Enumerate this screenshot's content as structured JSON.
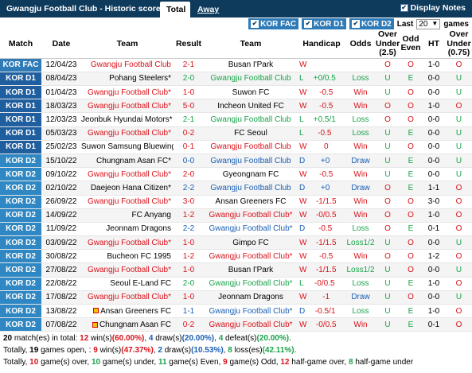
{
  "header": {
    "title": "Gwangju Football Club - Historic scores",
    "tab_total": "Total",
    "tab_away": "Away",
    "display_notes": "Display Notes"
  },
  "filters": {
    "items": [
      "KOR FAC",
      "KOR D1",
      "KOR D2"
    ],
    "last_label": "Last",
    "last_value": "20",
    "games_label": "games"
  },
  "columns": [
    "Match",
    "Date",
    "Team",
    "Result",
    "Team",
    "Handicap",
    "Odds",
    "Over Under (2.5)",
    "Odd Even",
    "HT",
    "Over Under (0.75)"
  ],
  "rows": [
    {
      "league": "KOR FAC",
      "lc": "l-fac",
      "date": "12/04/23",
      "home": "Gwangju Football Club",
      "hc": "red",
      "score": "2-1",
      "away": "Busan I'Park",
      "ac": "",
      "res": "W",
      "hcp": "",
      "odds": "",
      "ou": "O",
      "oe": "O",
      "ht": "1-0",
      "ou2": "O"
    },
    {
      "league": "KOR D1",
      "lc": "l-d1",
      "date": "08/04/23",
      "home": "Pohang Steelers*",
      "hc": "",
      "score": "2-0",
      "away": "Gwangju Football Club",
      "ac": "green",
      "res": "L",
      "hcp": "+0/0.5",
      "odds": "Loss",
      "ou": "U",
      "oe": "E",
      "ht": "0-0",
      "ou2": "U"
    },
    {
      "league": "KOR D1",
      "lc": "l-d1",
      "date": "01/04/23",
      "home": "Gwangju Football Club*",
      "hc": "red",
      "score": "1-0",
      "away": "Suwon FC",
      "ac": "",
      "res": "W",
      "hcp": "-0.5",
      "odds": "Win",
      "ou": "U",
      "oe": "O",
      "ht": "0-0",
      "ou2": "U"
    },
    {
      "league": "KOR D1",
      "lc": "l-d1",
      "date": "18/03/23",
      "home": "Gwangju Football Club*",
      "hc": "red",
      "score": "5-0",
      "away": "Incheon United FC",
      "ac": "",
      "res": "W",
      "hcp": "-0.5",
      "odds": "Win",
      "ou": "O",
      "oe": "O",
      "ht": "1-0",
      "ou2": "O"
    },
    {
      "league": "KOR D1",
      "lc": "l-d1",
      "date": "12/03/23",
      "home": "Jeonbuk Hyundai Motors*",
      "hc": "",
      "score": "2-1",
      "away": "Gwangju Football Club",
      "ac": "green",
      "res": "L",
      "hcp": "+0.5/1",
      "odds": "Loss",
      "ou": "O",
      "oe": "O",
      "ht": "0-0",
      "ou2": "U"
    },
    {
      "league": "KOR D1",
      "lc": "l-d1",
      "date": "05/03/23",
      "home": "Gwangju Football Club*",
      "hc": "red",
      "score": "0-2",
      "away": "FC Seoul",
      "ac": "",
      "res": "L",
      "hcp": "-0.5",
      "odds": "Loss",
      "ou": "U",
      "oe": "E",
      "ht": "0-0",
      "ou2": "U"
    },
    {
      "league": "KOR D1",
      "lc": "l-d1",
      "date": "25/02/23",
      "home": "Suwon Samsung Bluewings*",
      "hc": "",
      "score": "0-1",
      "away": "Gwangju Football Club",
      "ac": "red",
      "res": "W",
      "hcp": "0",
      "odds": "Win",
      "ou": "U",
      "oe": "O",
      "ht": "0-0",
      "ou2": "U"
    },
    {
      "league": "KOR D2",
      "lc": "l-d2",
      "date": "15/10/22",
      "home": "Chungnam Asan FC*",
      "hc": "",
      "score": "0-0",
      "away": "Gwangju Football Club",
      "ac": "blue",
      "res": "D",
      "hcp": "+0",
      "odds": "Draw",
      "ou": "U",
      "oe": "E",
      "ht": "0-0",
      "ou2": "U"
    },
    {
      "league": "KOR D2",
      "lc": "l-d2",
      "date": "09/10/22",
      "home": "Gwangju Football Club*",
      "hc": "red",
      "score": "2-0",
      "away": "Gyeongnam FC",
      "ac": "",
      "res": "W",
      "hcp": "-0.5",
      "odds": "Win",
      "ou": "U",
      "oe": "E",
      "ht": "0-0",
      "ou2": "U"
    },
    {
      "league": "KOR D2",
      "lc": "l-d2",
      "date": "02/10/22",
      "home": "Daejeon Hana Citizen*",
      "hc": "",
      "score": "2-2",
      "away": "Gwangju Football Club",
      "ac": "blue",
      "res": "D",
      "hcp": "+0",
      "odds": "Draw",
      "ou": "O",
      "oe": "E",
      "ht": "1-1",
      "ou2": "O"
    },
    {
      "league": "KOR D2",
      "lc": "l-d2",
      "date": "26/09/22",
      "home": "Gwangju Football Club*",
      "hc": "red",
      "score": "3-0",
      "away": "Ansan Greeners FC",
      "ac": "",
      "res": "W",
      "hcp": "-1/1.5",
      "odds": "Win",
      "ou": "O",
      "oe": "O",
      "ht": "3-0",
      "ou2": "O"
    },
    {
      "league": "KOR D2",
      "lc": "l-d2",
      "date": "14/09/22",
      "home": "FC Anyang",
      "hc": "",
      "score": "1-2",
      "away": "Gwangju Football Club*",
      "ac": "red",
      "res": "W",
      "hcp": "-0/0.5",
      "odds": "Win",
      "ou": "O",
      "oe": "O",
      "ht": "1-0",
      "ou2": "O"
    },
    {
      "league": "KOR D2",
      "lc": "l-d2",
      "date": "11/09/22",
      "home": "Jeonnam Dragons",
      "hc": "",
      "score": "2-2",
      "away": "Gwangju Football Club*",
      "ac": "blue",
      "res": "D",
      "hcp": "-0.5",
      "odds": "Loss",
      "ou": "O",
      "oe": "E",
      "ht": "0-1",
      "ou2": "O"
    },
    {
      "league": "KOR D2",
      "lc": "l-d2",
      "date": "03/09/22",
      "home": "Gwangju Football Club*",
      "hc": "red",
      "score": "1-0",
      "away": "Gimpo FC",
      "ac": "",
      "res": "W",
      "hcp": "-1/1.5",
      "odds": "Loss1/2",
      "ou": "U",
      "oe": "O",
      "ht": "0-0",
      "ou2": "U"
    },
    {
      "league": "KOR D2",
      "lc": "l-d2",
      "date": "30/08/22",
      "home": "Bucheon FC 1995",
      "hc": "",
      "score": "1-2",
      "away": "Gwangju Football Club*",
      "ac": "red",
      "res": "W",
      "hcp": "-0.5",
      "odds": "Win",
      "ou": "O",
      "oe": "O",
      "ht": "1-2",
      "ou2": "O"
    },
    {
      "league": "KOR D2",
      "lc": "l-d2",
      "date": "27/08/22",
      "home": "Gwangju Football Club*",
      "hc": "red",
      "score": "1-0",
      "away": "Busan I'Park",
      "ac": "",
      "res": "W",
      "hcp": "-1/1.5",
      "odds": "Loss1/2",
      "ou": "U",
      "oe": "O",
      "ht": "0-0",
      "ou2": "U"
    },
    {
      "league": "KOR D2",
      "lc": "l-d2",
      "date": "22/08/22",
      "home": "Seoul E-Land FC",
      "hc": "",
      "score": "2-0",
      "away": "Gwangju Football Club*",
      "ac": "green",
      "res": "L",
      "hcp": "-0/0.5",
      "odds": "Loss",
      "ou": "U",
      "oe": "E",
      "ht": "1-0",
      "ou2": "O"
    },
    {
      "league": "KOR D2",
      "lc": "l-d2",
      "date": "17/08/22",
      "home": "Gwangju Football Club*",
      "hc": "red",
      "score": "1-0",
      "away": "Jeonnam Dragons",
      "ac": "",
      "res": "W",
      "hcp": "-1",
      "odds": "Draw",
      "ou": "U",
      "oe": "O",
      "ht": "0-0",
      "ou2": "U"
    },
    {
      "league": "KOR D2",
      "lc": "l-d2",
      "date": "13/08/22",
      "home": "Ansan Greeners FC",
      "hc": "",
      "homeflag": true,
      "score": "1-1",
      "away": "Gwangju Football Club*",
      "ac": "blue",
      "res": "D",
      "hcp": "-0.5/1",
      "odds": "Loss",
      "ou": "U",
      "oe": "E",
      "ht": "1-0",
      "ou2": "O"
    },
    {
      "league": "KOR D2",
      "lc": "l-d2",
      "date": "07/08/22",
      "home": "Chungnam Asan FC",
      "hc": "",
      "homeflag": true,
      "score": "0-2",
      "away": "Gwangju Football Club*",
      "ac": "red",
      "res": "W",
      "hcp": "-0/0.5",
      "odds": "Win",
      "ou": "U",
      "oe": "E",
      "ht": "0-1",
      "ou2": "O"
    }
  ],
  "summary": {
    "line1": {
      "a": "20",
      "b": " match(es) in total: ",
      "c": "12",
      "d": " win(s)",
      "e": "(60.00%)",
      "f": ", ",
      "g": "4",
      "h": " draw(s)",
      "i": "(20.00%)",
      "j": ", ",
      "k": "4",
      "l": " defeat(s)",
      "m": "(20.00%)",
      "n": "."
    },
    "line2": {
      "a": "Totally, ",
      "b": "19",
      "c": " games open, : ",
      "d": "9",
      "e": " win(s)",
      "f": "(47.37%)",
      "g": ", ",
      "h": "2",
      "i": " draw(s)",
      "j": "(10.53%)",
      "k": ", ",
      "l": "8",
      "m": " loss(es)",
      "n": "(42.11%)",
      "o": "."
    },
    "line3": {
      "a": "Totally, ",
      "b": "10",
      "c": " game(s) over, ",
      "d": "10",
      "e": " game(s) under, ",
      "f": "11",
      "g": " game(s) Even, ",
      "h": "9",
      "i": " game(s) Odd, ",
      "j": "12",
      "k": " half-game over, ",
      "l": "8",
      "m": " half-game under"
    }
  },
  "colors": {
    "topbar": "#0e3a5c",
    "win": "#d8131b",
    "draw": "#1a5fb4",
    "loss": "#19a34a"
  }
}
